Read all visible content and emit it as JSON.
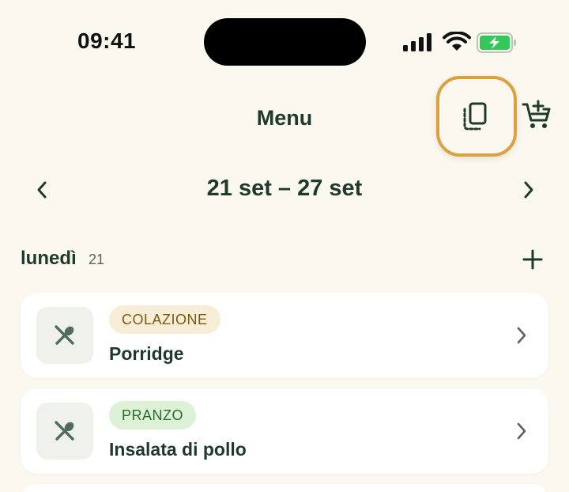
{
  "status_bar": {
    "time": "09:41"
  },
  "header": {
    "title": "Menu"
  },
  "week": {
    "range": "21 set – 27 set"
  },
  "day": {
    "name": "lunedì",
    "number": "21"
  },
  "meals": [
    {
      "type": "COLAZIONE",
      "name": "Porridge"
    },
    {
      "type": "PRANZO",
      "name": "Insalata di pollo"
    }
  ],
  "colors": {
    "background": "#fbf8ef",
    "primary_text": "#1f3a2c",
    "highlight_ring": "#d9a13f",
    "breakfast_tag_bg": "#f8edd6",
    "breakfast_tag_text": "#7a5a12",
    "lunch_tag_bg": "#dcf1d5",
    "lunch_tag_text": "#2a6a30",
    "battery_charging": "#34c759"
  },
  "icons": {
    "copy_week": "copy-pages-icon",
    "add_to_cart": "cart-plus-icon",
    "prev_week": "chevron-left-icon",
    "next_week": "chevron-right-icon",
    "add_meal": "plus-icon",
    "meal_thumb": "fork-spoon-icon",
    "open_meal": "chevron-right-icon"
  }
}
